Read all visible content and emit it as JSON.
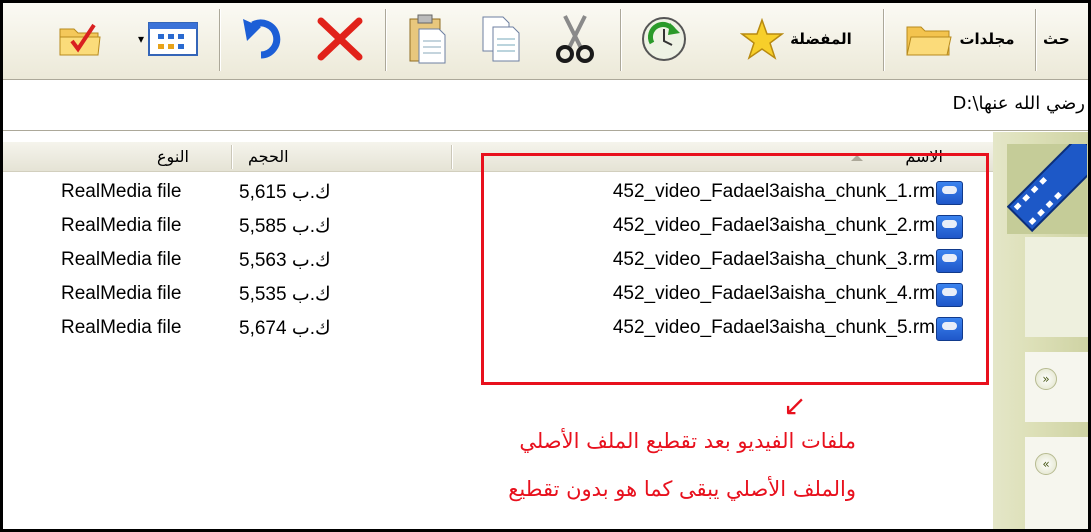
{
  "toolbar": {
    "search_label": "حث",
    "folders_label": "مجلدات",
    "favorites_label": "المفضلة"
  },
  "address": {
    "path": "D:\\رضي الله عنها"
  },
  "columns": {
    "name": "الاسم",
    "size": "الحجم",
    "type": "النوع"
  },
  "files": [
    {
      "name": "452_video_Fadael3aisha_chunk_1.rm",
      "size": "5,615 ك.ب",
      "type": "RealMedia file"
    },
    {
      "name": "452_video_Fadael3aisha_chunk_2.rm",
      "size": "5,585 ك.ب",
      "type": "RealMedia file"
    },
    {
      "name": "452_video_Fadael3aisha_chunk_3.rm",
      "size": "5,563 ك.ب",
      "type": "RealMedia file"
    },
    {
      "name": "452_video_Fadael3aisha_chunk_4.rm",
      "size": "5,535 ك.ب",
      "type": "RealMedia file"
    },
    {
      "name": "452_video_Fadael3aisha_chunk_5.rm",
      "size": "5,674 ك.ب",
      "type": "RealMedia file"
    }
  ],
  "annotation": {
    "line1": "ملفات الفيديو بعد تقطيع الملف الأصلي",
    "line2": "والملف الأصلي يبقى كما هو بدون تقطيع",
    "color": "#e8101d"
  },
  "icons": [
    "views-icon",
    "folder-icon",
    "star-icon",
    "sync-icon",
    "cut-icon",
    "copy-icon",
    "paste-icon",
    "delete-icon",
    "undo-icon",
    "views-grid-icon",
    "checklist-folder-icon",
    "film-strip-icon",
    "chevron-down-icon",
    "chevron-up-icon",
    "realmedia-file-icon"
  ]
}
